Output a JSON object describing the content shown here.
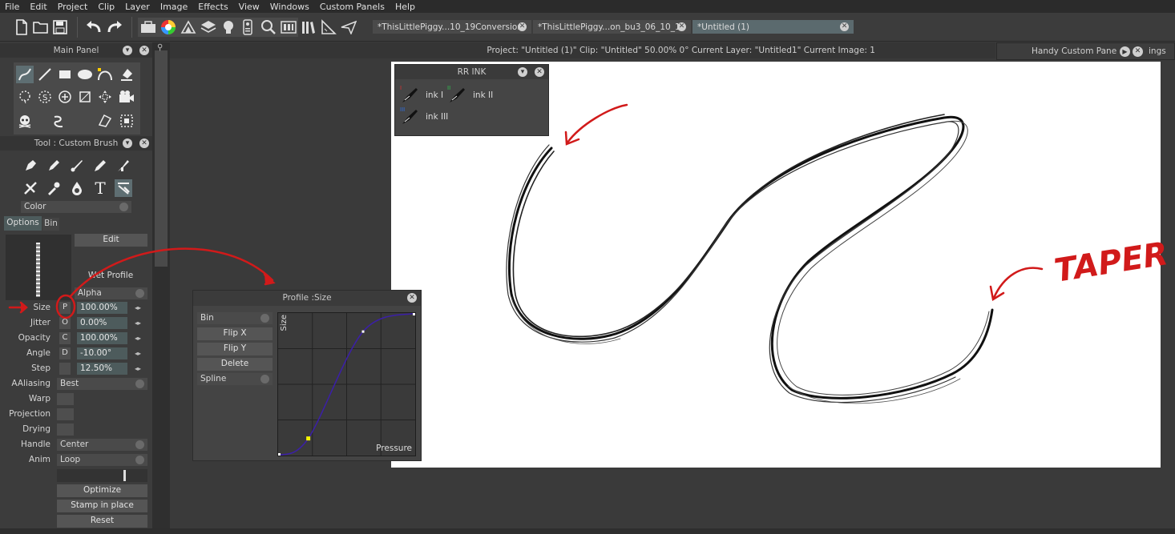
{
  "menu": [
    "File",
    "Edit",
    "Project",
    "Clip",
    "Layer",
    "Image",
    "Effects",
    "View",
    "Windows",
    "Custom Panels",
    "Help"
  ],
  "tabs": [
    {
      "label": "*ThisLittlePiggy...10_19Conversion"
    },
    {
      "label": "*ThisLittlePiggy...on_bu3_06_10_19"
    },
    {
      "label": "*Untitled (1)"
    }
  ],
  "status": {
    "text": "Project:  \"Untitled (1)\"  Clip: \"Untitled\"   50.00%   0°  Current Layer: \"Untitled1\"  Current Image: 1",
    "handy_panel": "Handy Custom Pane",
    "handy_cut": "ings"
  },
  "main_panel": {
    "title": "Main Panel"
  },
  "tool_panel": {
    "title": "Tool : Custom Brush",
    "color_dropdown": "Color",
    "tab_options": "Options",
    "tab_bin": "Bin",
    "edit_button": "Edit",
    "wet_profile": "Wet Profile",
    "alpha_dropdown": "Alpha",
    "rows": [
      {
        "label": "Size",
        "mod": "P",
        "value": "100.00%"
      },
      {
        "label": "Jitter",
        "mod": "O",
        "value": "0.00%"
      },
      {
        "label": "Opacity",
        "mod": "C",
        "value": "100.00%"
      },
      {
        "label": "Angle",
        "mod": "D",
        "value": "-10.00°"
      },
      {
        "label": "Step",
        "mod": "",
        "value": "12.50%"
      }
    ],
    "aaliasing": {
      "label": "AAliasing",
      "value": "Best"
    },
    "warp": "Warp",
    "projection": "Projection",
    "drying": "Drying",
    "handle": {
      "label": "Handle",
      "value": "Center"
    },
    "anim": {
      "label": "Anim",
      "value": "Loop"
    },
    "optimize": "Optimize",
    "stamp": "Stamp in place",
    "reset": "Reset"
  },
  "rr_ink": {
    "title": "RR INK",
    "items": [
      {
        "name": "ink I",
        "badge": "I"
      },
      {
        "name": "ink II",
        "badge": "II"
      },
      {
        "name": "ink III",
        "badge": "III"
      }
    ]
  },
  "profile": {
    "title": "Profile :Size",
    "bin": "Bin",
    "flip_x": "Flip X",
    "flip_y": "Flip Y",
    "delete": "Delete",
    "spline": "Spline",
    "y_axis": "Size",
    "x_axis": "Pressure",
    "curve_points": [
      [
        0,
        0
      ],
      [
        0.22,
        0.12
      ],
      [
        0.62,
        0.87
      ],
      [
        1,
        1
      ]
    ]
  },
  "annotation": {
    "taper": "TAPER",
    "color": "#d11a1a"
  },
  "colors": {
    "accent_tab": "#5b6a6e",
    "field": "#4d5b5c",
    "curve": "#3b1fa8"
  }
}
